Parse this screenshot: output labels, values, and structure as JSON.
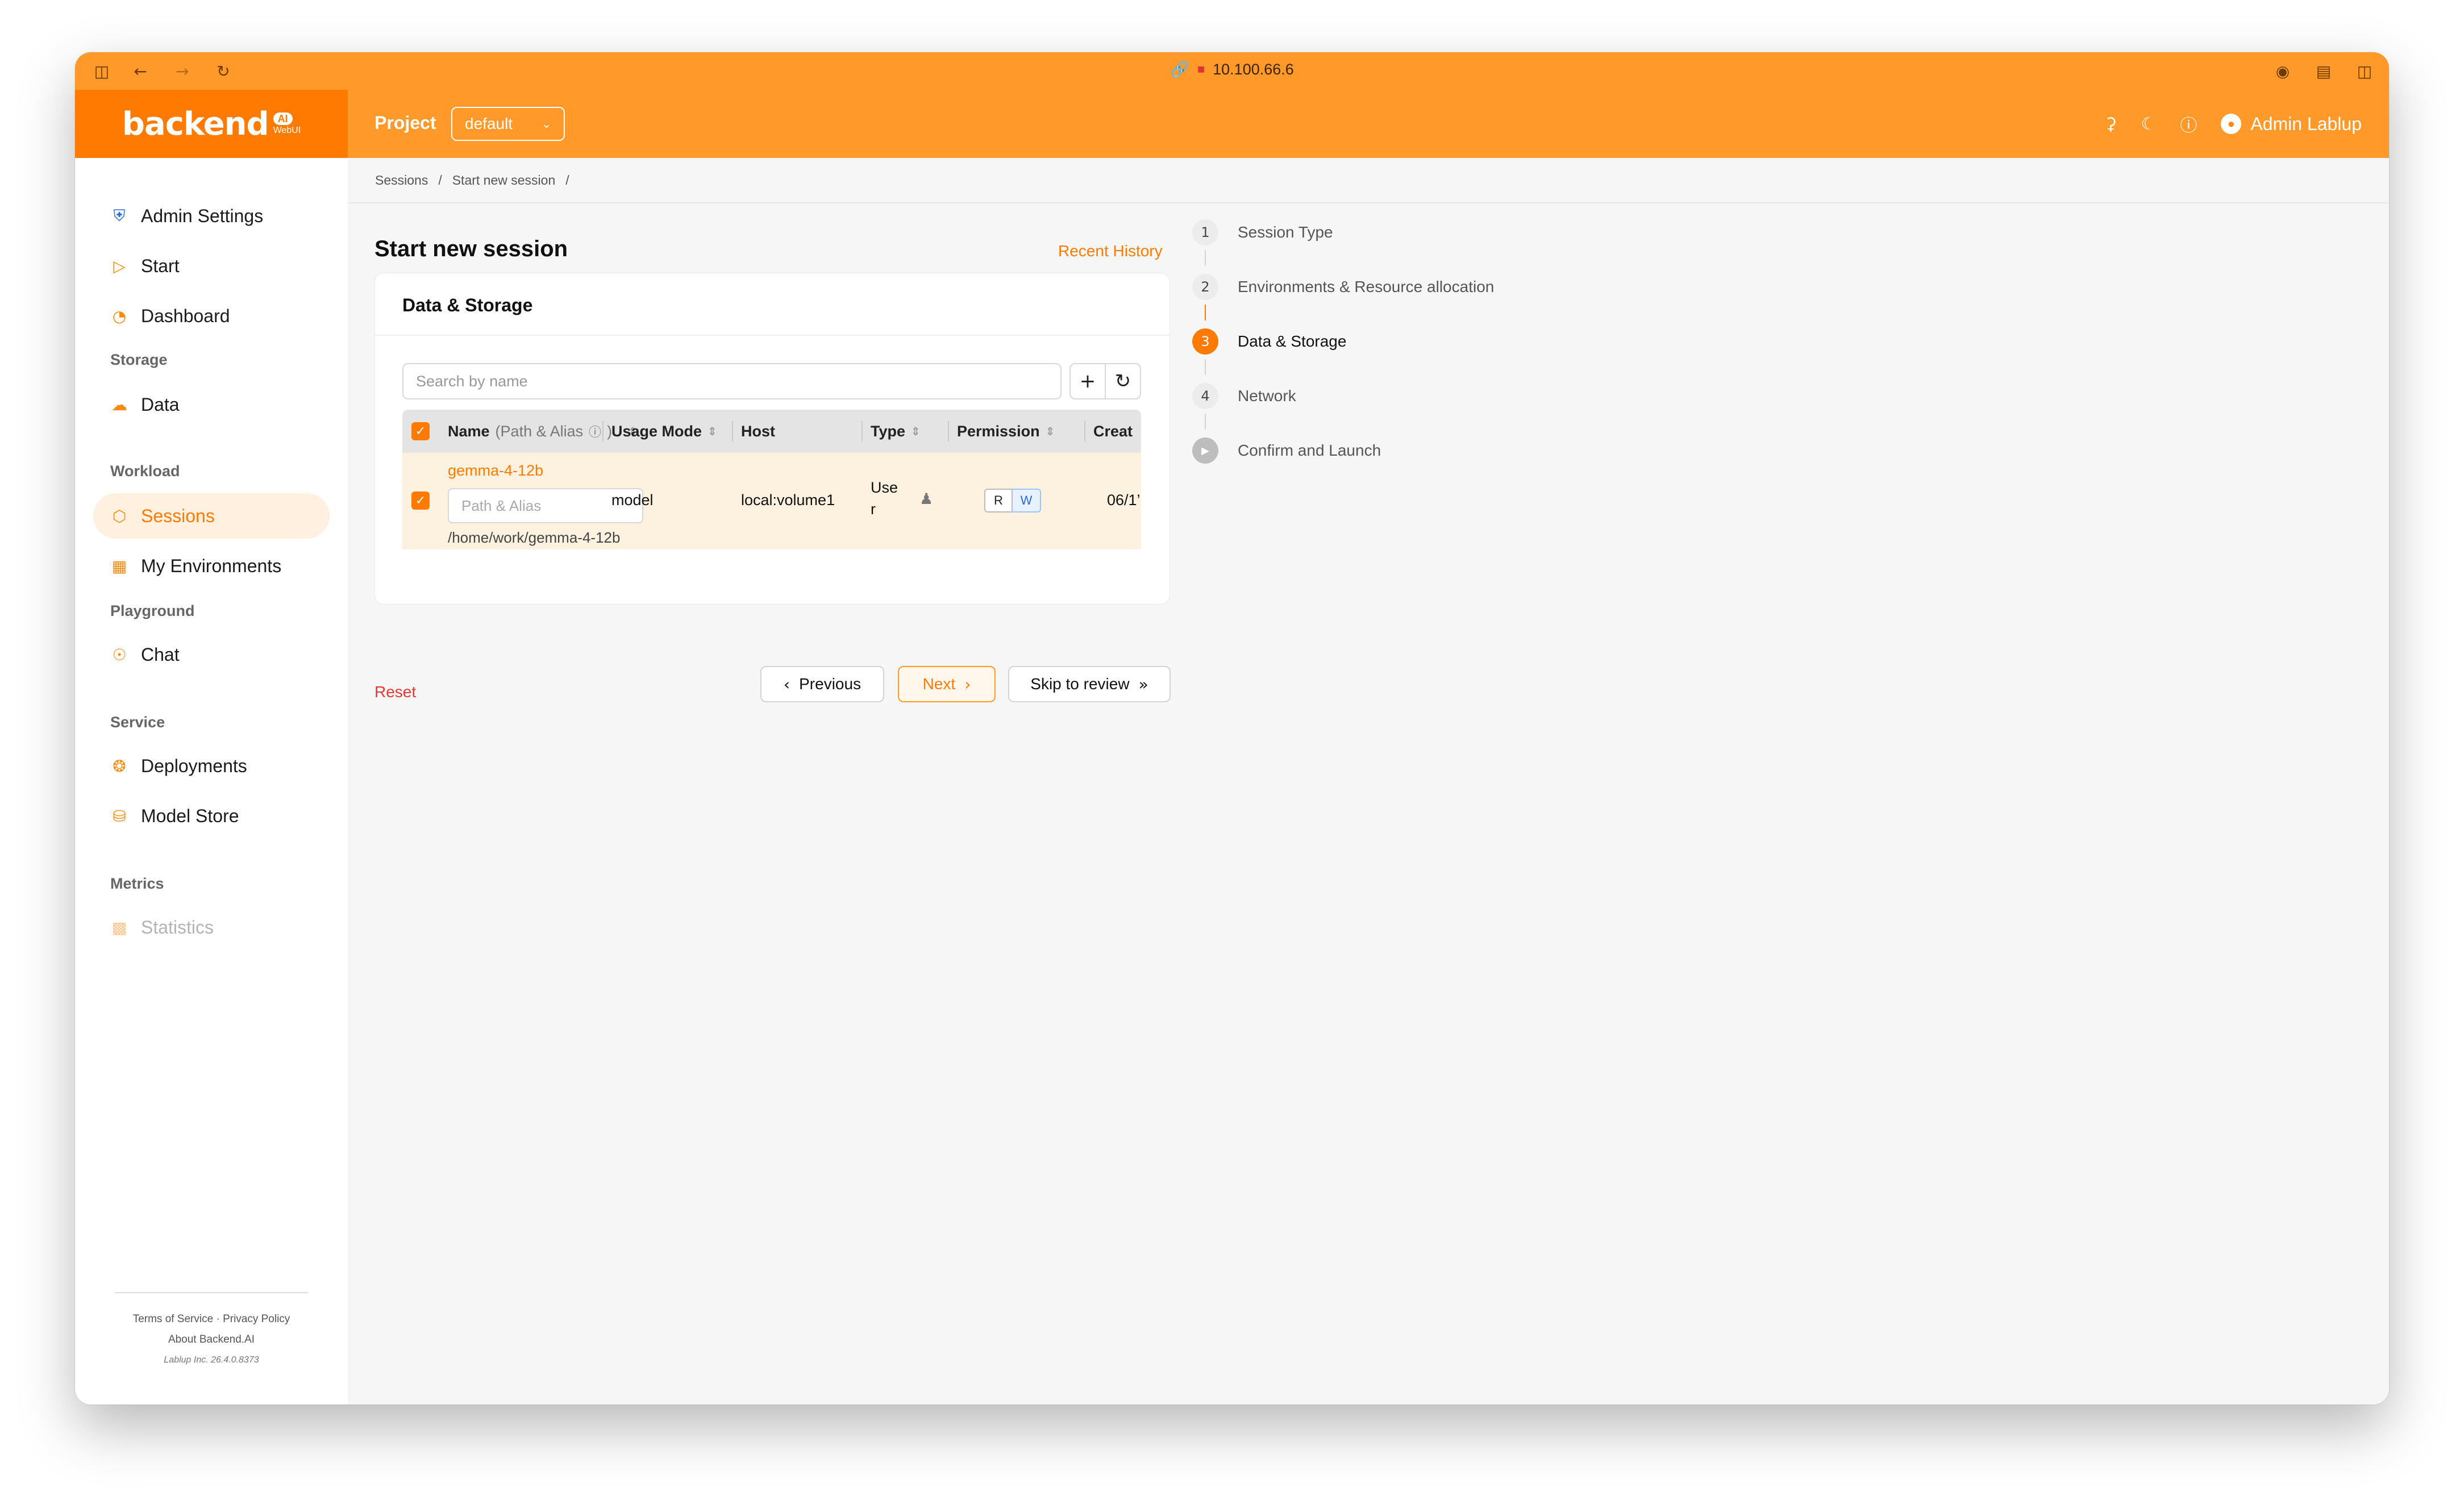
{
  "browser": {
    "url": "10.100.66.6"
  },
  "header": {
    "logo": "backend",
    "logo_badge": "AI",
    "logo_sub": "WebUI",
    "project_label": "Project",
    "project_value": "default",
    "user_name": "Admin Lablup"
  },
  "sidebar": {
    "items": {
      "admin_settings": "Admin Settings",
      "start": "Start",
      "dashboard": "Dashboard",
      "data": "Data",
      "sessions": "Sessions",
      "my_environments": "My Environments",
      "chat": "Chat",
      "deployments": "Deployments",
      "model_store": "Model Store",
      "statistics": "Statistics"
    },
    "groups": {
      "storage": "Storage",
      "workload": "Workload",
      "playground": "Playground",
      "service": "Service",
      "metrics": "Metrics"
    },
    "footer": {
      "terms": "Terms of Service",
      "privacy": "Privacy Policy",
      "about": "About Backend.AI",
      "version": "Lablup Inc. 26.4.0.8373"
    }
  },
  "breadcrumb": {
    "items": [
      "Sessions",
      "Start new session"
    ],
    "separator": "/"
  },
  "main": {
    "title": "Start new session",
    "recent_history": "Recent History",
    "card_title": "Data & Storage",
    "search_placeholder": "Search by name",
    "table": {
      "headers": {
        "name": "Name",
        "name_sub": "(Path & Alias",
        "usage_mode": "Usage Mode",
        "host": "Host",
        "type": "Type",
        "permission": "Permission",
        "created": "Creat"
      },
      "rows": [
        {
          "name": "gemma-4-12b",
          "alias_placeholder": "Path & Alias",
          "path": "/home/work/gemma-4-12b",
          "usage_mode": "model",
          "host": "local:volume1",
          "type_line1": "Use",
          "type_line2": "r",
          "perm_r": "R",
          "perm_w": "W",
          "created": "06/1’"
        }
      ]
    },
    "reset": "Reset",
    "buttons": {
      "previous": "Previous",
      "next": "Next",
      "skip": "Skip to review"
    }
  },
  "steps": [
    {
      "num": "1",
      "label": "Session Type"
    },
    {
      "num": "2",
      "label": "Environments & Resource allocation"
    },
    {
      "num": "3",
      "label": "Data & Storage"
    },
    {
      "num": "4",
      "label": "Network"
    },
    {
      "num": "▶",
      "label": "Confirm and Launch"
    }
  ],
  "colors": {
    "brand": "#ff7a00",
    "header": "#ff9a2a",
    "danger": "#e53935",
    "write": "#2a6bdc"
  }
}
